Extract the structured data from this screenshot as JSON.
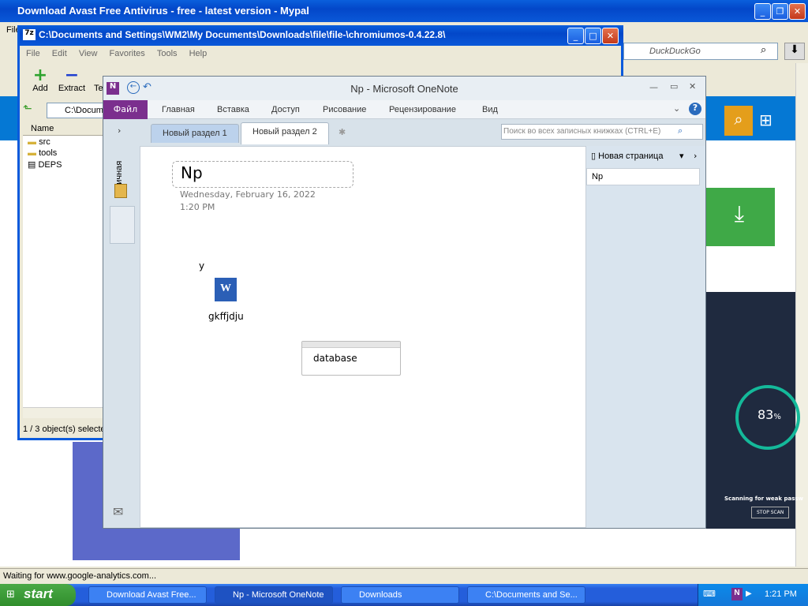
{
  "browser": {
    "title": "Download Avast Free Antivirus - free - latest version - Mypal",
    "search_placeholder": "DuckDuckGo",
    "status": "Waiting for www.google-analytics.com...",
    "file_menu": "File"
  },
  "explorer": {
    "title": "C:\\Documents and Settings\\WM2\\My Documents\\Downloads\\file\\file-\\chromiumos-0.4.22.8\\",
    "menu": [
      "File",
      "Edit",
      "View",
      "Favorites",
      "Tools",
      "Help"
    ],
    "toolbar": {
      "add": "Add",
      "extract": "Extract",
      "test": "Te"
    },
    "address": "C:\\Docum",
    "column_name": "Name",
    "files": [
      "src",
      "tools",
      "DEPS"
    ],
    "status": "1 / 3 object(s) selecte"
  },
  "onenote": {
    "title": "Np  -  Microsoft OneNote",
    "ribbon": {
      "file": "Файл",
      "tabs": [
        "Главная",
        "Вставка",
        "Доступ",
        "Рисование",
        "Рецензирование",
        "Вид"
      ]
    },
    "sections": [
      "Новый раздел 1",
      "Новый раздел 2"
    ],
    "search_placeholder": "Поиск во всех записных книжках (CTRL+E)",
    "notebook_label": "Личная",
    "page": {
      "title": "Np",
      "date": "Wednesday, February 16, 2022",
      "time": "1:20 PM",
      "text_y": "y",
      "attachment": "gkffjdju",
      "note": "database"
    },
    "pages_panel": {
      "new_page": "Новая страница",
      "items": [
        "Np"
      ]
    }
  },
  "avast": {
    "percent": "83",
    "percent_sign": "%",
    "scanning": "Scanning for weak passw",
    "stop": "STOP SCAN"
  },
  "taskbar": {
    "start": "start",
    "tasks": [
      "Download Avast Free...",
      "Np - Microsoft OneNote",
      "Downloads",
      "C:\\Documents and Se..."
    ],
    "clock": "1:21 PM"
  }
}
